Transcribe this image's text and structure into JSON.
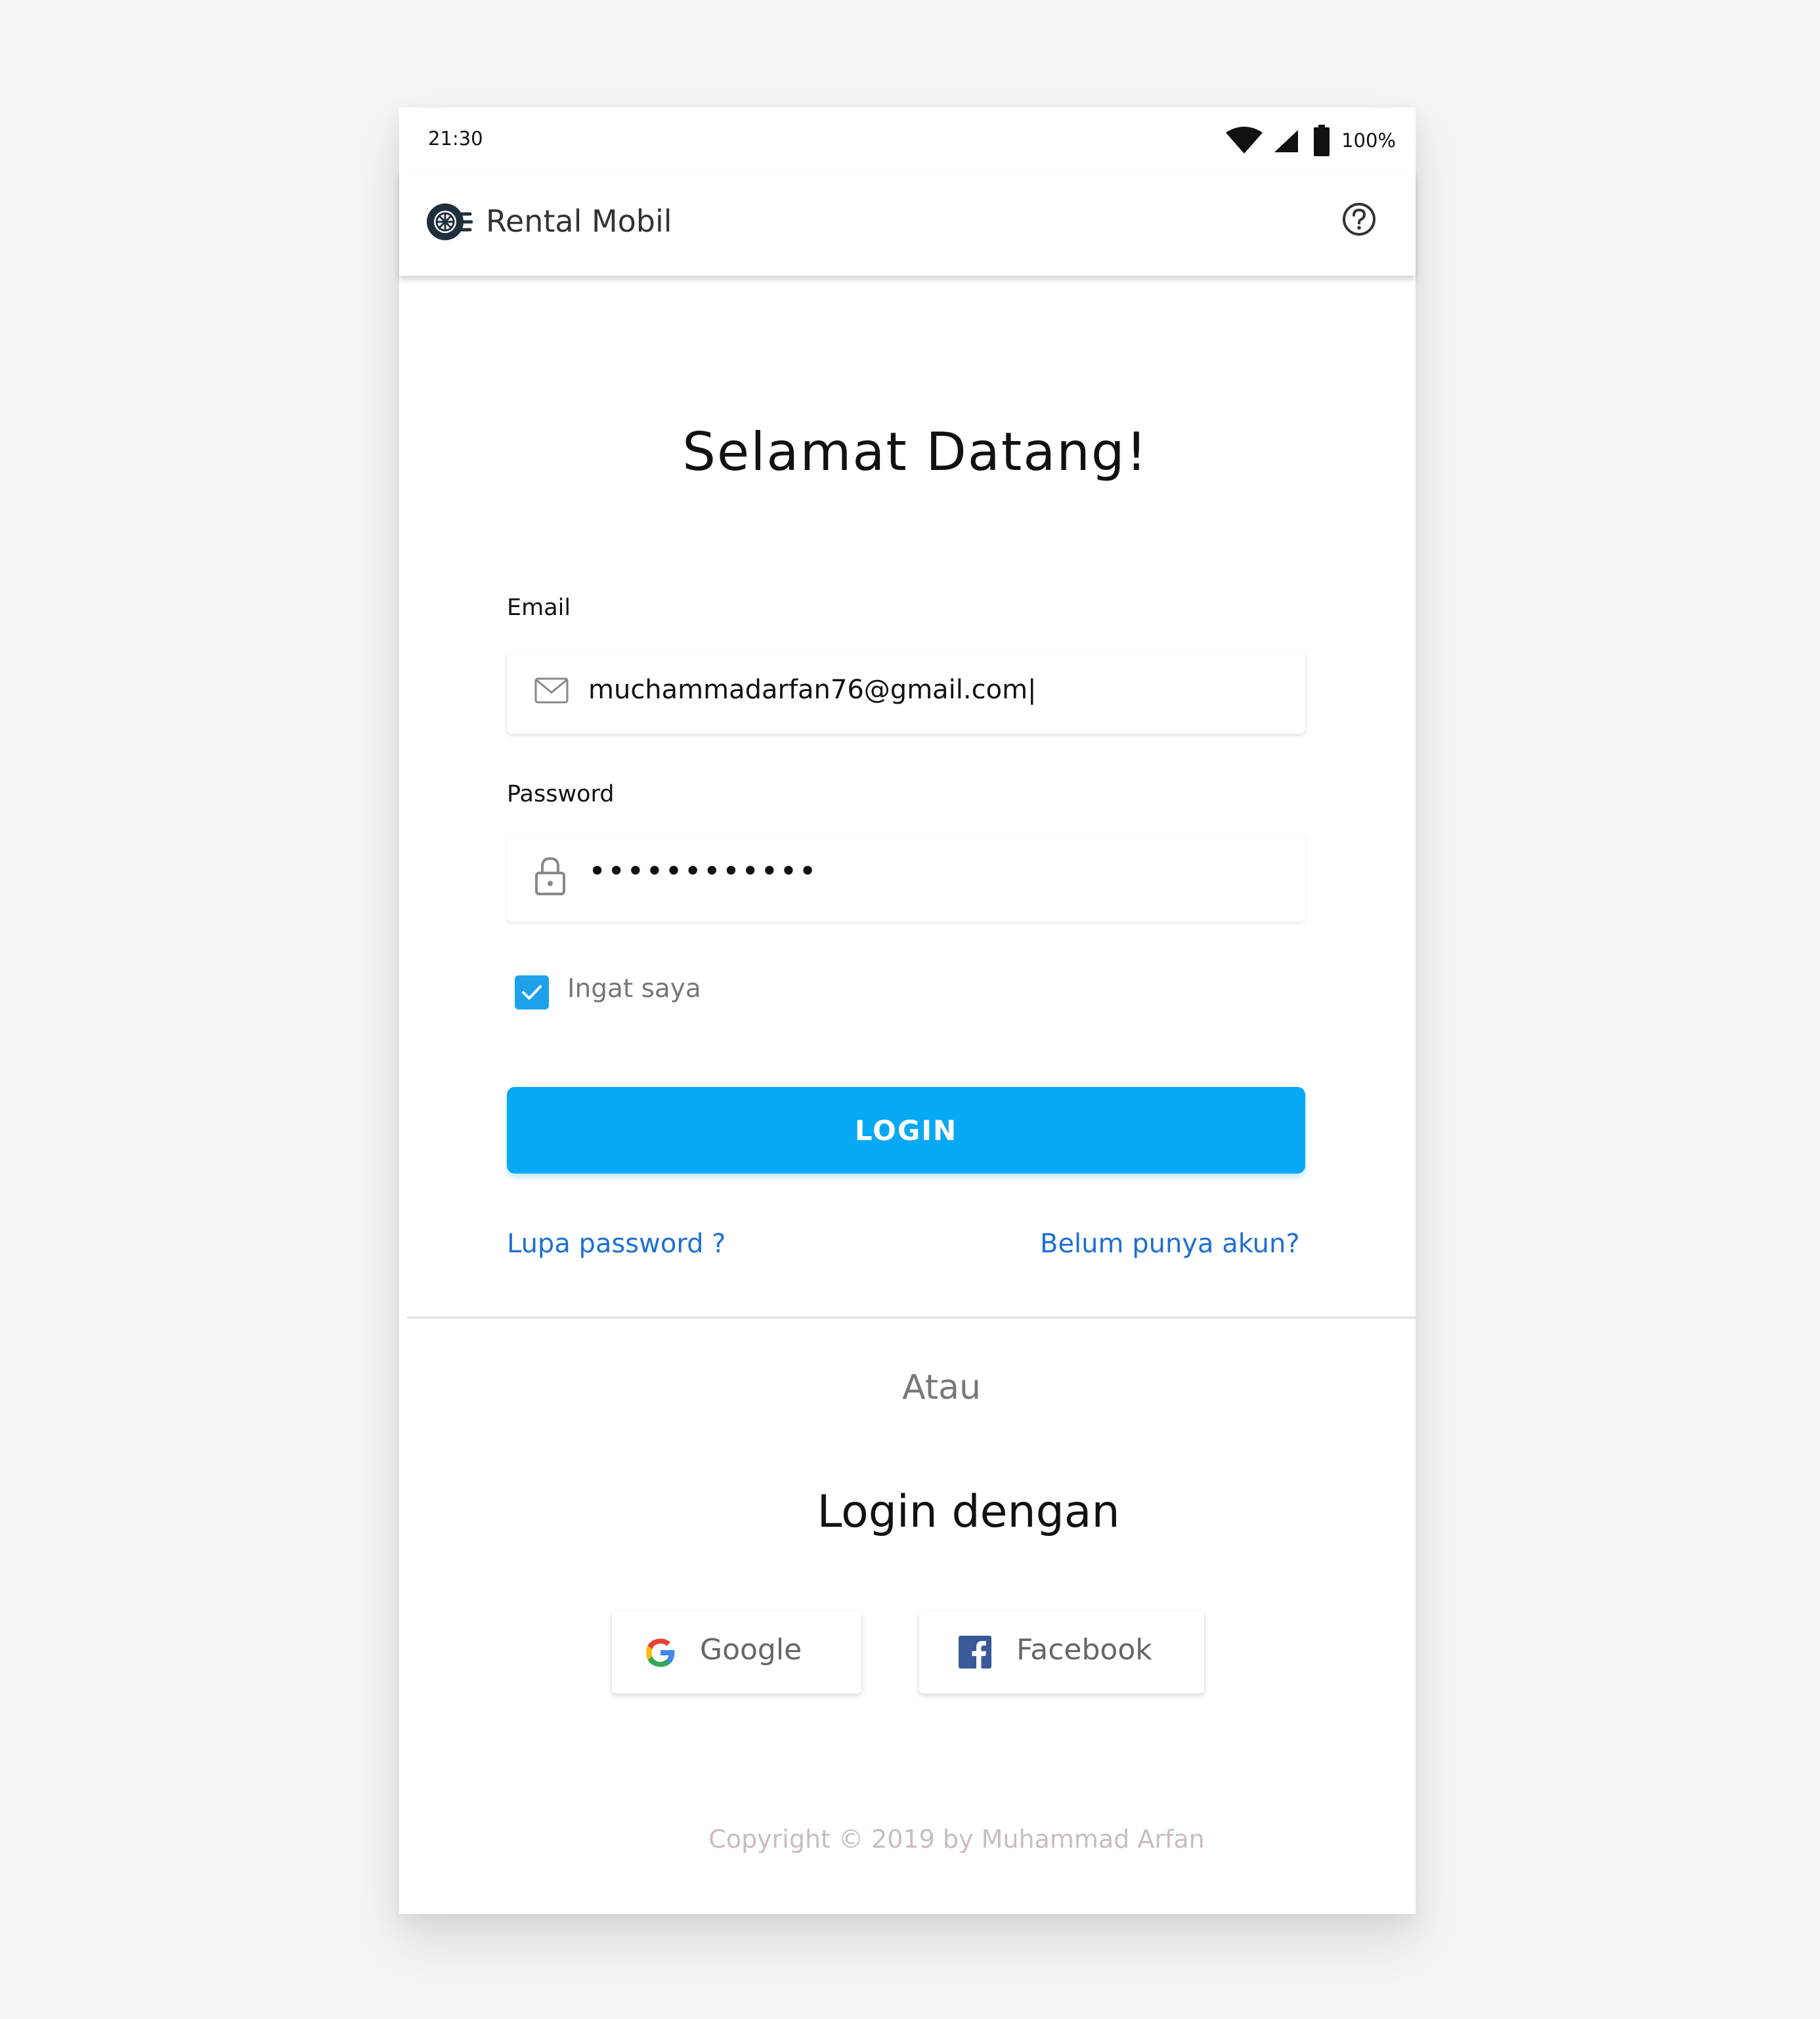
{
  "status_bar": {
    "time": "21:30",
    "battery": "100%"
  },
  "app_bar": {
    "title": "Rental Mobil",
    "logo_icon": "car-wheel-logo-icon",
    "help_icon": "help-circle-icon"
  },
  "login_form": {
    "heading": "Selamat Datang!",
    "email_label": "Email",
    "email_value": "muchammadarfan76@gmail.com|",
    "email_icon": "mail-icon",
    "password_label": "Password",
    "password_value": "••••••••••••",
    "password_icon": "lock-icon",
    "remember_label": "Ingat saya",
    "remember_checked": true,
    "login_button": "LOGIN",
    "forgot_link": "Lupa password ?",
    "register_link": "Belum punya akun?"
  },
  "social_login": {
    "or_text": "Atau",
    "heading": "Login dengan",
    "google_label": "Google",
    "facebook_label": "Facebook"
  },
  "footer": {
    "copyright": "Copyright © 2019 by Muhammad Arfan"
  },
  "colors": {
    "accent": "#07a8f4",
    "link": "#1e6fd4",
    "checkbox": "#1ea1ea",
    "facebook": "#3b5998"
  }
}
